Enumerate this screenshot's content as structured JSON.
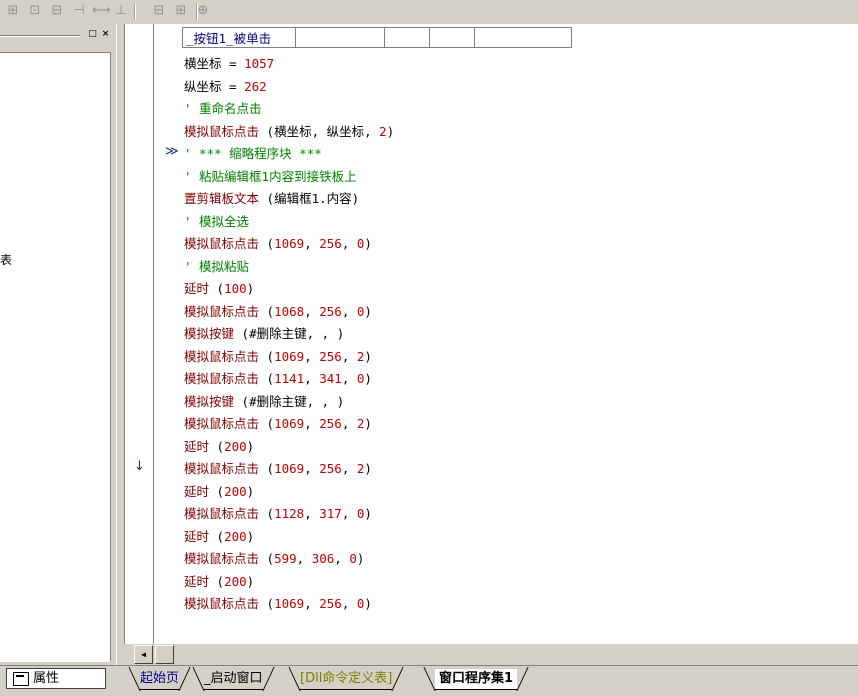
{
  "colors": {
    "function": "#800000",
    "number": "#c00000",
    "comment": "#008000",
    "table_text": "#000080",
    "marker": "#1b2f8a"
  },
  "toolbar": {
    "buttons": [
      "align-grid-icon",
      "align-center-icon",
      "align-top-icon",
      "align-vcenter-icon",
      "distribute-horizontal-icon",
      "distribute-vertical-icon",
      "same-width-icon",
      "same-height-icon",
      "same-size-icon"
    ],
    "glyphs": [
      "⊞",
      "⊡",
      "⊟",
      "⊣",
      "⟷",
      "⊥",
      "⊟",
      "⊞",
      "⊕"
    ]
  },
  "left_panel": {
    "partial_text": "表",
    "buttons": {
      "restore": "□",
      "close": "×"
    }
  },
  "editor": {
    "header_cell": "_按钮1_被单击",
    "fold_marker": "≫",
    "arrow_marker": "↓",
    "lines": [
      {
        "parts": [
          {
            "t": "横坐标",
            "c": "plain"
          },
          {
            "t": " = ",
            "c": "plain"
          },
          {
            "t": "1057",
            "c": "num"
          }
        ]
      },
      {
        "parts": [
          {
            "t": "纵坐标",
            "c": "plain"
          },
          {
            "t": " = ",
            "c": "plain"
          },
          {
            "t": "262",
            "c": "num"
          }
        ]
      },
      {
        "parts": [
          {
            "t": "' 重命名点击",
            "c": "cmt"
          }
        ]
      },
      {
        "parts": [
          {
            "t": "模拟鼠标点击",
            "c": "fn"
          },
          {
            "t": " (横坐标, 纵坐标, ",
            "c": "plain"
          },
          {
            "t": "2",
            "c": "num"
          },
          {
            "t": ")",
            "c": "plain"
          }
        ]
      },
      {
        "parts": [
          {
            "t": "' *** 缩略程序块 ***",
            "c": "cmt"
          }
        ]
      },
      {
        "parts": [
          {
            "t": "' 粘贴编辑框1内容到接铁板上",
            "c": "cmt"
          }
        ]
      },
      {
        "parts": [
          {
            "t": "置剪辑板文本",
            "c": "fn"
          },
          {
            "t": " (编辑框1.内容)",
            "c": "plain"
          }
        ]
      },
      {
        "parts": [
          {
            "t": "' 模拟全选",
            "c": "cmt"
          }
        ]
      },
      {
        "parts": [
          {
            "t": "模拟鼠标点击",
            "c": "fn"
          },
          {
            "t": " (",
            "c": "plain"
          },
          {
            "t": "1069",
            "c": "num"
          },
          {
            "t": ", ",
            "c": "plain"
          },
          {
            "t": "256",
            "c": "num"
          },
          {
            "t": ", ",
            "c": "plain"
          },
          {
            "t": "0",
            "c": "num"
          },
          {
            "t": ")",
            "c": "plain"
          }
        ]
      },
      {
        "parts": [
          {
            "t": "' 模拟粘贴",
            "c": "cmt"
          }
        ]
      },
      {
        "parts": [
          {
            "t": "延时",
            "c": "fn"
          },
          {
            "t": " (",
            "c": "plain"
          },
          {
            "t": "100",
            "c": "num"
          },
          {
            "t": ")",
            "c": "plain"
          }
        ]
      },
      {
        "parts": [
          {
            "t": "模拟鼠标点击",
            "c": "fn"
          },
          {
            "t": " (",
            "c": "plain"
          },
          {
            "t": "1068",
            "c": "num"
          },
          {
            "t": ", ",
            "c": "plain"
          },
          {
            "t": "256",
            "c": "num"
          },
          {
            "t": ", ",
            "c": "plain"
          },
          {
            "t": "0",
            "c": "num"
          },
          {
            "t": ")",
            "c": "plain"
          }
        ]
      },
      {
        "parts": [
          {
            "t": "模拟按键",
            "c": "fn"
          },
          {
            "t": " (#删除主键, , )",
            "c": "plain"
          }
        ]
      },
      {
        "parts": [
          {
            "t": "模拟鼠标点击",
            "c": "fn"
          },
          {
            "t": " (",
            "c": "plain"
          },
          {
            "t": "1069",
            "c": "num"
          },
          {
            "t": ", ",
            "c": "plain"
          },
          {
            "t": "256",
            "c": "num"
          },
          {
            "t": ", ",
            "c": "plain"
          },
          {
            "t": "2",
            "c": "num"
          },
          {
            "t": ")",
            "c": "plain"
          }
        ]
      },
      {
        "parts": [
          {
            "t": "模拟鼠标点击",
            "c": "fn"
          },
          {
            "t": " (",
            "c": "plain"
          },
          {
            "t": "1141",
            "c": "num"
          },
          {
            "t": ", ",
            "c": "plain"
          },
          {
            "t": "341",
            "c": "num"
          },
          {
            "t": ", ",
            "c": "plain"
          },
          {
            "t": "0",
            "c": "num"
          },
          {
            "t": ")",
            "c": "plain"
          }
        ]
      },
      {
        "parts": [
          {
            "t": "模拟按键",
            "c": "fn"
          },
          {
            "t": " (#删除主键, , )",
            "c": "plain"
          }
        ]
      },
      {
        "parts": [
          {
            "t": "模拟鼠标点击",
            "c": "fn"
          },
          {
            "t": " (",
            "c": "plain"
          },
          {
            "t": "1069",
            "c": "num"
          },
          {
            "t": ", ",
            "c": "plain"
          },
          {
            "t": "256",
            "c": "num"
          },
          {
            "t": ", ",
            "c": "plain"
          },
          {
            "t": "2",
            "c": "num"
          },
          {
            "t": ")",
            "c": "plain"
          }
        ]
      },
      {
        "parts": [
          {
            "t": "延时",
            "c": "fn"
          },
          {
            "t": " (",
            "c": "plain"
          },
          {
            "t": "200",
            "c": "num"
          },
          {
            "t": ")",
            "c": "plain"
          }
        ]
      },
      {
        "parts": [
          {
            "t": "模拟鼠标点击",
            "c": "fn"
          },
          {
            "t": " (",
            "c": "plain"
          },
          {
            "t": "1069",
            "c": "num"
          },
          {
            "t": ", ",
            "c": "plain"
          },
          {
            "t": "256",
            "c": "num"
          },
          {
            "t": ", ",
            "c": "plain"
          },
          {
            "t": "2",
            "c": "num"
          },
          {
            "t": ")",
            "c": "plain"
          }
        ]
      },
      {
        "parts": [
          {
            "t": "延时",
            "c": "fn"
          },
          {
            "t": " (",
            "c": "plain"
          },
          {
            "t": "200",
            "c": "num"
          },
          {
            "t": ")",
            "c": "plain"
          }
        ]
      },
      {
        "parts": [
          {
            "t": "模拟鼠标点击",
            "c": "fn"
          },
          {
            "t": " (",
            "c": "plain"
          },
          {
            "t": "1128",
            "c": "num"
          },
          {
            "t": ", ",
            "c": "plain"
          },
          {
            "t": "317",
            "c": "num"
          },
          {
            "t": ", ",
            "c": "plain"
          },
          {
            "t": "0",
            "c": "num"
          },
          {
            "t": ")",
            "c": "plain"
          }
        ]
      },
      {
        "parts": [
          {
            "t": "延时",
            "c": "fn"
          },
          {
            "t": " (",
            "c": "plain"
          },
          {
            "t": "200",
            "c": "num"
          },
          {
            "t": ")",
            "c": "plain"
          }
        ]
      },
      {
        "parts": [
          {
            "t": "模拟鼠标点击",
            "c": "fn"
          },
          {
            "t": " (",
            "c": "plain"
          },
          {
            "t": "599",
            "c": "num"
          },
          {
            "t": ", ",
            "c": "plain"
          },
          {
            "t": "306",
            "c": "num"
          },
          {
            "t": ", ",
            "c": "plain"
          },
          {
            "t": "0",
            "c": "num"
          },
          {
            "t": ")",
            "c": "plain"
          }
        ]
      },
      {
        "parts": [
          {
            "t": "延时",
            "c": "fn"
          },
          {
            "t": " (",
            "c": "plain"
          },
          {
            "t": "200",
            "c": "num"
          },
          {
            "t": ")",
            "c": "plain"
          }
        ]
      },
      {
        "parts": [
          {
            "t": "模拟鼠标点击",
            "c": "fn"
          },
          {
            "t": " (",
            "c": "plain"
          },
          {
            "t": "1069",
            "c": "num"
          },
          {
            "t": ", ",
            "c": "plain"
          },
          {
            "t": "256",
            "c": "num"
          },
          {
            "t": ", ",
            "c": "plain"
          },
          {
            "t": "0",
            "c": "num"
          },
          {
            "t": ")",
            "c": "plain"
          }
        ]
      }
    ]
  },
  "bottom": {
    "properties_label": "属性",
    "scroll_left": "◀",
    "tabs": [
      {
        "label": "起始页",
        "color": "#000080",
        "active": false
      },
      {
        "label": "_启动窗口",
        "color": "#000",
        "active": false
      },
      {
        "label": "[Dll命令定义表]",
        "color": "#808000",
        "active": false
      },
      {
        "label": "窗口程序集1",
        "color": "#000",
        "active": true
      }
    ]
  }
}
